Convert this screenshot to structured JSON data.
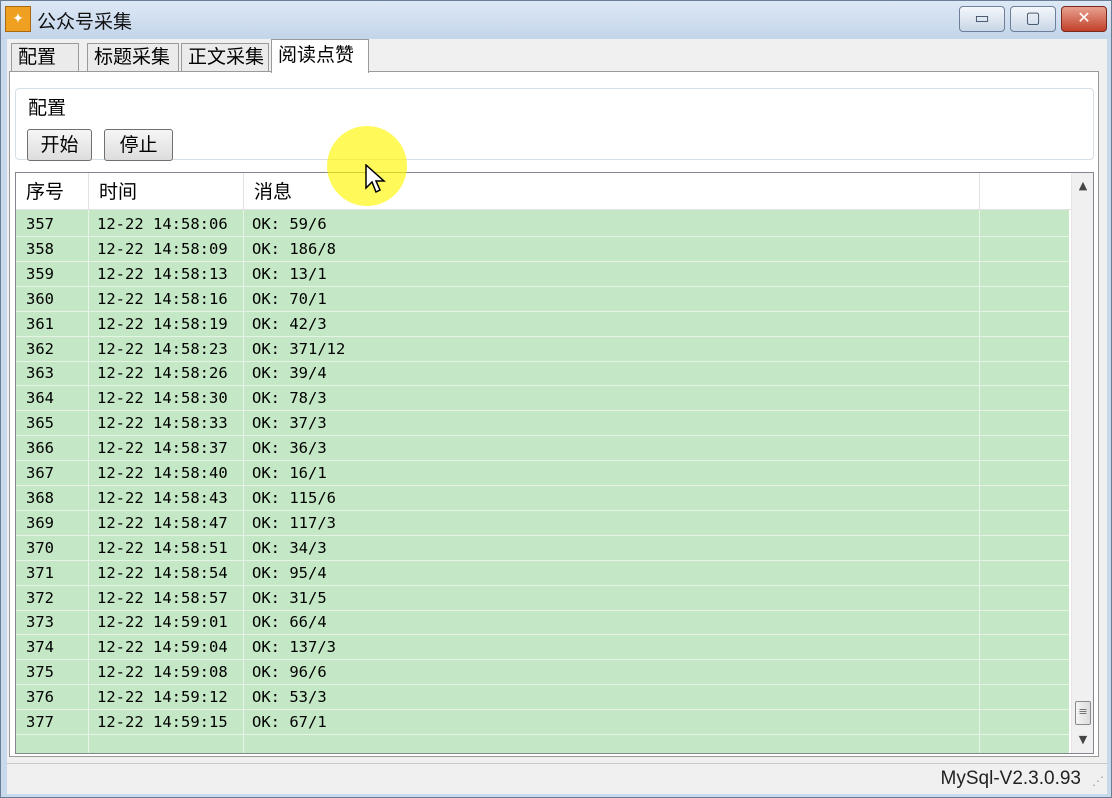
{
  "window": {
    "title": "公众号采集",
    "controls": {
      "minimize": "▭",
      "maximize": "▢",
      "close": "✕"
    }
  },
  "tabs": [
    "配置",
    "标题采集",
    "正文采集",
    "阅读点赞"
  ],
  "active_tab": "阅读点赞",
  "config_group": {
    "label": "配置",
    "start_label": "开始",
    "stop_label": "停止"
  },
  "list": {
    "columns": [
      "序号",
      "时间",
      "消息",
      ""
    ],
    "rows": [
      {
        "no": "357",
        "time": "12-22 14:58:06",
        "msg": "OK: 59/6"
      },
      {
        "no": "358",
        "time": "12-22 14:58:09",
        "msg": "OK: 186/8"
      },
      {
        "no": "359",
        "time": "12-22 14:58:13",
        "msg": "OK: 13/1"
      },
      {
        "no": "360",
        "time": "12-22 14:58:16",
        "msg": "OK: 70/1"
      },
      {
        "no": "361",
        "time": "12-22 14:58:19",
        "msg": "OK: 42/3"
      },
      {
        "no": "362",
        "time": "12-22 14:58:23",
        "msg": "OK: 371/12"
      },
      {
        "no": "363",
        "time": "12-22 14:58:26",
        "msg": "OK: 39/4"
      },
      {
        "no": "364",
        "time": "12-22 14:58:30",
        "msg": "OK: 78/3"
      },
      {
        "no": "365",
        "time": "12-22 14:58:33",
        "msg": "OK: 37/3"
      },
      {
        "no": "366",
        "time": "12-22 14:58:37",
        "msg": "OK: 36/3"
      },
      {
        "no": "367",
        "time": "12-22 14:58:40",
        "msg": "OK: 16/1"
      },
      {
        "no": "368",
        "time": "12-22 14:58:43",
        "msg": "OK: 115/6"
      },
      {
        "no": "369",
        "time": "12-22 14:58:47",
        "msg": "OK: 117/3"
      },
      {
        "no": "370",
        "time": "12-22 14:58:51",
        "msg": "OK: 34/3"
      },
      {
        "no": "371",
        "time": "12-22 14:58:54",
        "msg": "OK: 95/4"
      },
      {
        "no": "372",
        "time": "12-22 14:58:57",
        "msg": "OK: 31/5"
      },
      {
        "no": "373",
        "time": "12-22 14:59:01",
        "msg": "OK: 66/4"
      },
      {
        "no": "374",
        "time": "12-22 14:59:04",
        "msg": "OK: 137/3"
      },
      {
        "no": "375",
        "time": "12-22 14:59:08",
        "msg": "OK: 96/6"
      },
      {
        "no": "376",
        "time": "12-22 14:59:12",
        "msg": "OK: 53/3"
      },
      {
        "no": "377",
        "time": "12-22 14:59:15",
        "msg": "OK: 67/1"
      }
    ],
    "row_color": "#c4e8c6"
  },
  "scrollbar": {
    "up_icon": "▲",
    "down_icon": "▼",
    "thumb_icon": "≡"
  },
  "statusbar": {
    "text": "MySql-V2.3.0.93",
    "grip": "⋰"
  }
}
